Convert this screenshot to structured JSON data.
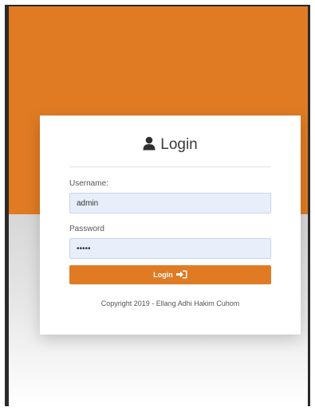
{
  "login": {
    "title": "Login",
    "username_label": "Username:",
    "username_value": "admin",
    "password_label": "Password",
    "password_value": "•••••",
    "button_label": "Login",
    "button_icon": "sign-in-icon",
    "title_icon": "user-icon",
    "copyright": "Copyright 2019 - Ellang Adhi Hakim Cuhom"
  },
  "colors": {
    "accent": "#e07b24",
    "input_bg": "#e8effb"
  }
}
